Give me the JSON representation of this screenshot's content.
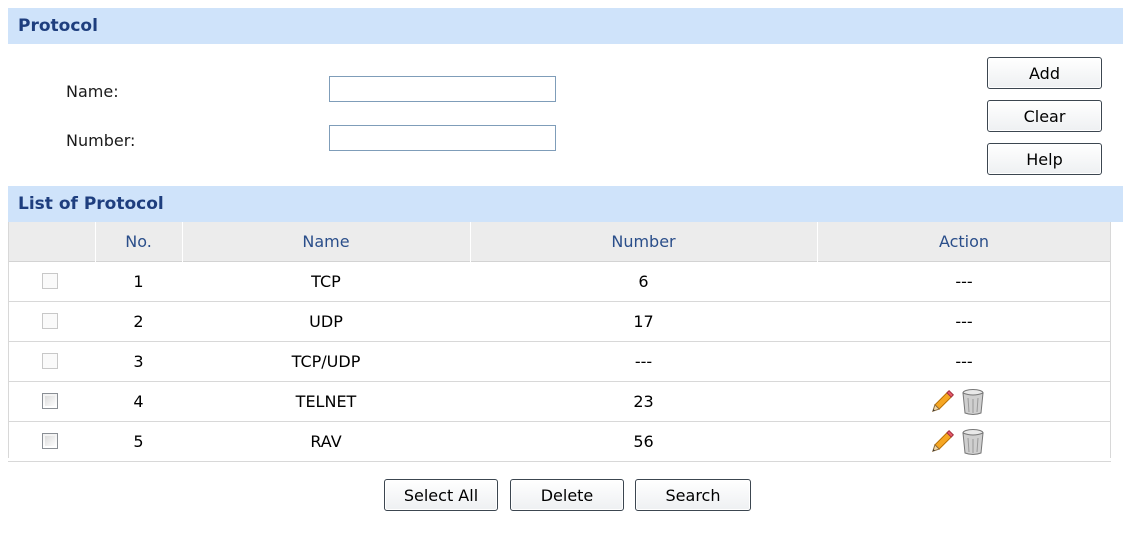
{
  "protocol_section": {
    "title": "Protocol"
  },
  "form": {
    "name_label": "Name:",
    "name_value": "",
    "number_label": "Number:",
    "number_value": ""
  },
  "side_buttons": {
    "add": "Add",
    "clear": "Clear",
    "help": "Help"
  },
  "list_section": {
    "title": "List of Protocol"
  },
  "table": {
    "headers": {
      "no": "No.",
      "name": "Name",
      "number": "Number",
      "action": "Action"
    },
    "rows": [
      {
        "no": "1",
        "name": "TCP",
        "number": "6",
        "action": "---"
      },
      {
        "no": "2",
        "name": "UDP",
        "number": "17",
        "action": "---"
      },
      {
        "no": "3",
        "name": "TCP/UDP",
        "number": "---",
        "action": "---"
      },
      {
        "no": "4",
        "name": "TELNET",
        "number": "23",
        "action": ""
      },
      {
        "no": "5",
        "name": "RAV",
        "number": "56",
        "action": ""
      }
    ]
  },
  "bottom_buttons": {
    "select_all": "Select All",
    "delete": "Delete",
    "search": "Search"
  },
  "colors": {
    "header_bg": "#cfe3fa",
    "header_text": "#1e3e7e",
    "column_header_text": "#2a4e8a",
    "column_header_bg": "#ececec"
  },
  "icons": {
    "edit": "pencil-icon",
    "delete": "trash-can-icon"
  }
}
